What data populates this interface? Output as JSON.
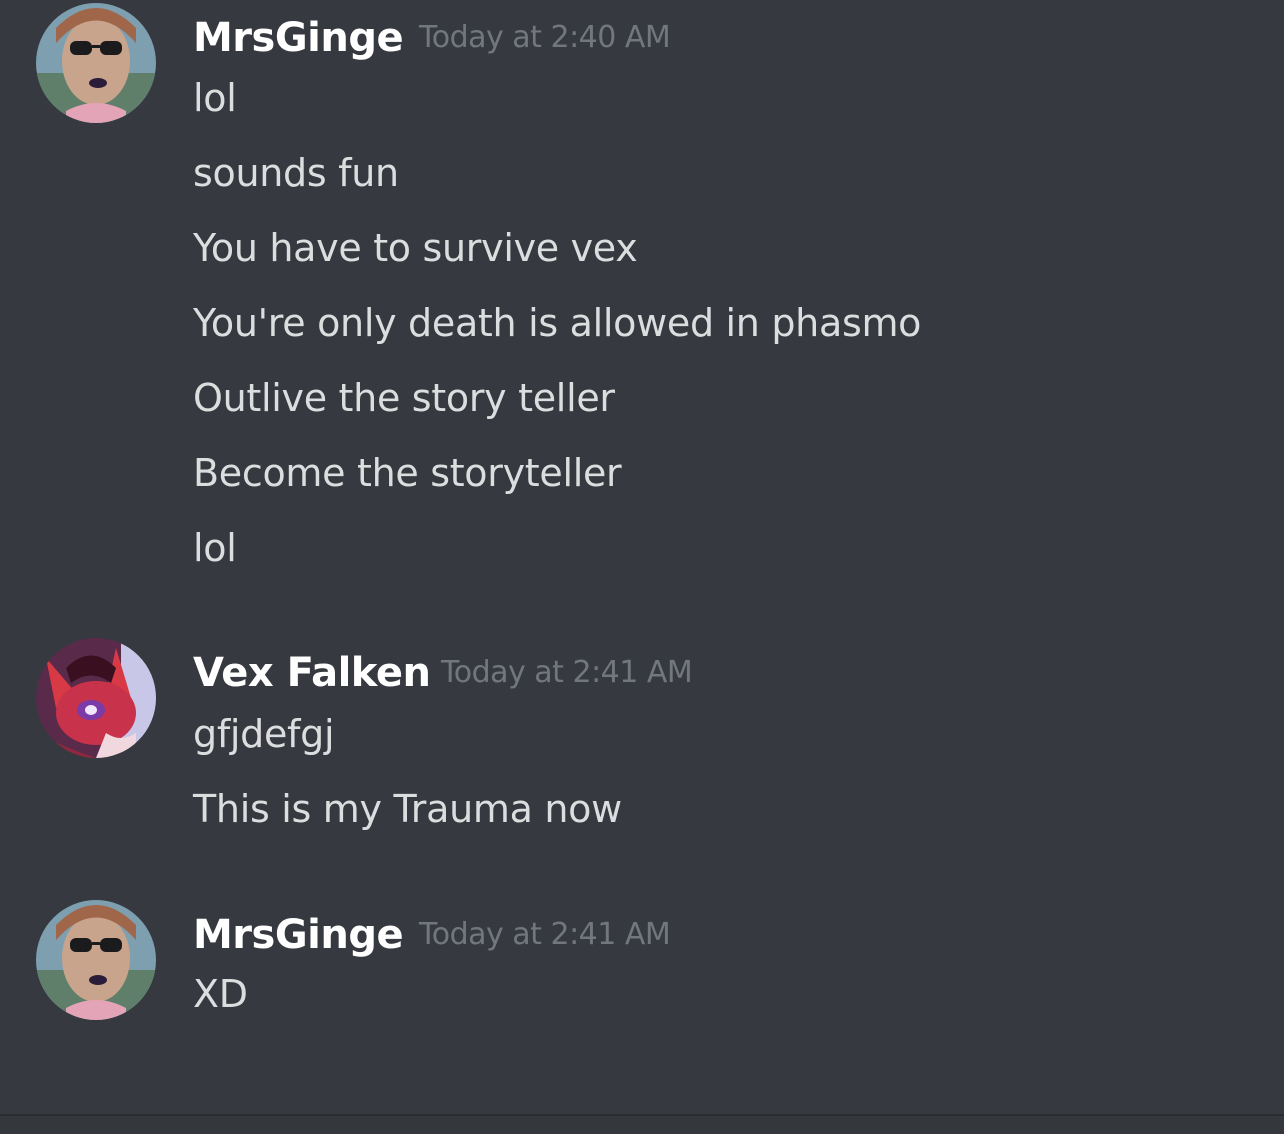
{
  "messages": [
    {
      "author": "MrsGinge",
      "timestamp": "Today at 2:40 AM",
      "avatar_icon": "user-avatar-sunglasses-photo",
      "lines": [
        "lol",
        "sounds fun",
        "You have to survive vex",
        "You're only death is allowed in phasmo",
        "Outlive the story teller",
        "Become the storyteller",
        "lol"
      ]
    },
    {
      "author": "Vex Falken",
      "timestamp": "Today at 2:41 AM",
      "avatar_icon": "user-avatar-red-fox-character",
      "lines": [
        "gfjdefgj",
        "This is my Trauma now"
      ]
    },
    {
      "author": "MrsGinge",
      "timestamp": "Today at 2:41 AM",
      "avatar_icon": "user-avatar-sunglasses-photo",
      "lines": [
        "XD"
      ]
    }
  ],
  "colors": {
    "background": "#36393f",
    "username": "#ffffff",
    "timestamp": "#72767d",
    "message_text": "#dcddde"
  }
}
